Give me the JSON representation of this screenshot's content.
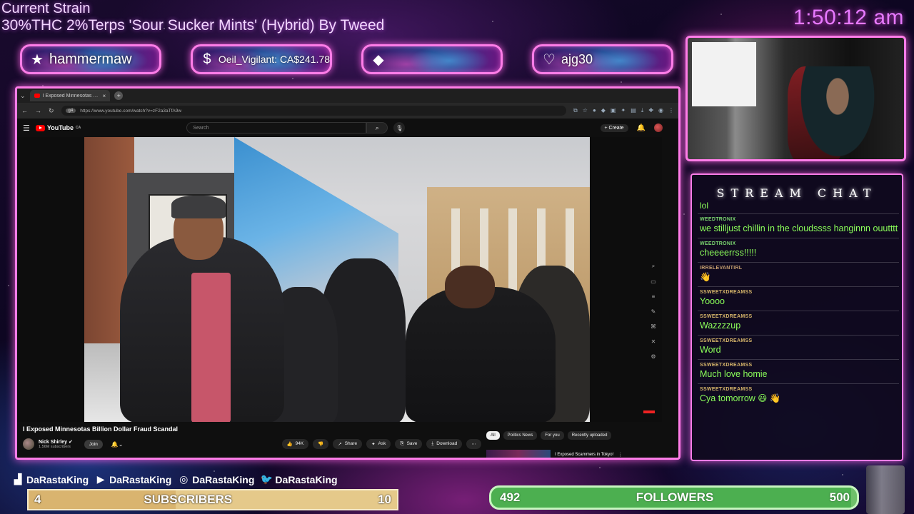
{
  "overlay": {
    "strain_title": "Current Strain",
    "strain_desc": "30%THC 2%Terps 'Sour Sucker Mints' (Hybrid) By  Tweed",
    "clock": "1:50:12 am",
    "accent_color": "#ff7de8"
  },
  "alerts": [
    {
      "icon": "star-icon",
      "glyph": "★",
      "text": "hammermaw"
    },
    {
      "icon": "dollar-icon",
      "glyph": "$",
      "text": "Oeil_Vigilant: CA$241.78"
    },
    {
      "icon": "diamond-icon",
      "glyph": "◆",
      "text": ""
    },
    {
      "icon": "heart-icon",
      "glyph": "♡",
      "text": "ajg30"
    }
  ],
  "browser": {
    "tab_title": "I Exposed Minnesotas Bil...",
    "tab_close": "×",
    "new_tab": "+",
    "url_chip": "g4",
    "url": "https://www.youtube.com/watch?v=zF2a3aTfA9w"
  },
  "youtube": {
    "logo": "YouTube",
    "logo_sup": "CA",
    "search_placeholder": "Search",
    "create_label": "+ Create",
    "video_title": "I Exposed Minnesotas Billion Dollar Fraud Scandal",
    "channel_name": "Nick Shirley ✔",
    "channel_subs": "1.56M subscribers",
    "join_label": "Join",
    "like_count": "94K",
    "actions": {
      "share": "Share",
      "ask": "Ask",
      "save": "Save",
      "download": "Download",
      "more": "⋯"
    },
    "chips": [
      "All",
      "Politics News",
      "For you",
      "Recently uploaded"
    ],
    "up_next_title": "I Exposed Scammers in Tokyo!"
  },
  "chat": {
    "title": "STREAM CHAT",
    "first_line": "lol",
    "messages": [
      {
        "user": "WEEDTRONIX",
        "text": "we stilljust chillin in the cloudssss hanginnn ouutttt"
      },
      {
        "user": "WEEDTRONIX",
        "text": "cheeeerrss!!!!!"
      },
      {
        "user": "IRRELEVANTIRL",
        "text": "👋"
      },
      {
        "user": "SSWEETXDREAMSS",
        "text": "Yoooo"
      },
      {
        "user": "SSWEETXDREAMSS",
        "text": "Wazzzzup"
      },
      {
        "user": "SSWEETXDREAMSS",
        "text": "Word"
      },
      {
        "user": "SSWEETXDREAMSS",
        "text": "Much love homie"
      },
      {
        "user": "SSWEETXDREAMSS",
        "text": "Cya tomorrow 😃 👋"
      }
    ]
  },
  "socials": [
    {
      "icon": "twitch-icon",
      "handle": "DaRastaKing"
    },
    {
      "icon": "youtube-icon",
      "handle": "DaRastaKing"
    },
    {
      "icon": "instagram-icon",
      "handle": "DaRastaKing"
    },
    {
      "icon": "twitter-icon",
      "handle": "DaRastaKing"
    }
  ],
  "subscribers": {
    "current": "4",
    "label": "SUBSCRIBERS",
    "goal": "10",
    "progress": 0.4
  },
  "followers": {
    "current": "492",
    "label": "FOLLOWERS",
    "goal": "500",
    "progress": 0.984
  }
}
